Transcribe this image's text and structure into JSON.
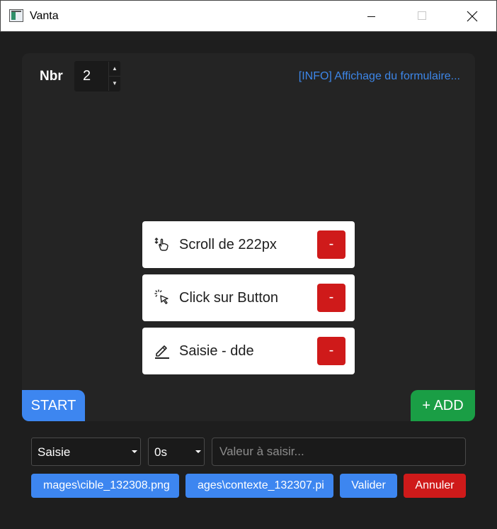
{
  "window": {
    "title": "Vanta",
    "icons": {
      "app": "app-icon",
      "minimize": "minimize-icon",
      "maximize": "maximize-icon",
      "close": "close-icon"
    }
  },
  "toolbar": {
    "nbr_label": "Nbr",
    "nbr_value": "2",
    "info": "[INFO] Affichage du formulaire..."
  },
  "actions": [
    {
      "icon": "scroll-hand-icon",
      "label": "Scroll de 222px",
      "remove": "-"
    },
    {
      "icon": "click-cursor-icon",
      "label": "Click sur Button",
      "remove": "-"
    },
    {
      "icon": "pen-icon",
      "label": "Saisie - dde",
      "remove": "-"
    }
  ],
  "buttons": {
    "start": "START",
    "add": "+ ADD"
  },
  "form": {
    "type_select": "Saisie",
    "delay_select": "0s",
    "value_placeholder": "Valeur à saisir...",
    "image_target": "mages\\cible_132308.png",
    "image_context": "ages\\contexte_132307.pi",
    "validate": "Valider",
    "cancel": "Annuler"
  },
  "colors": {
    "accent_blue": "#3d86f0",
    "add_green": "#1a9e45",
    "danger_red": "#cf1a1a",
    "info_blue": "#3d86e8",
    "panel_bg": "#242424",
    "window_bg": "#1e1e1e"
  }
}
